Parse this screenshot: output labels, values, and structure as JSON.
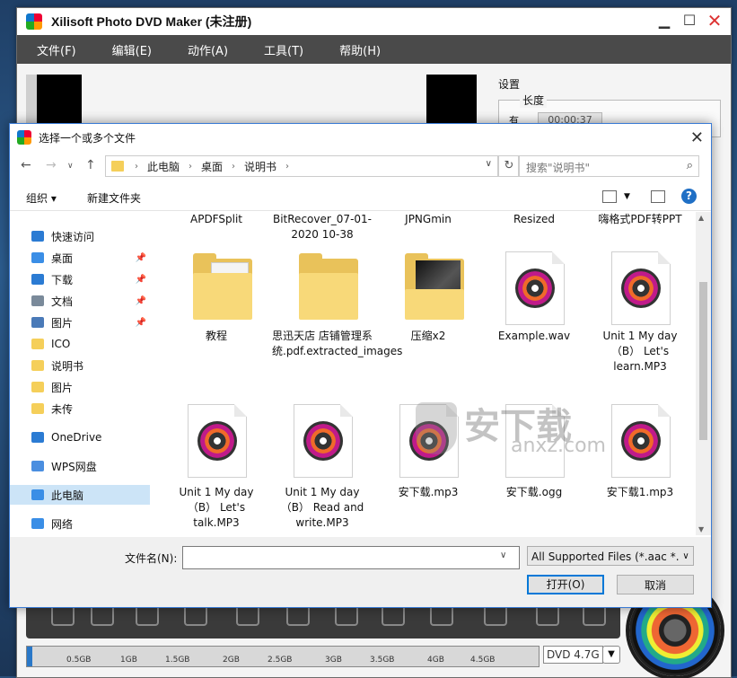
{
  "app": {
    "title": "Xilisoft Photo DVD Maker (未注册)",
    "menu": [
      "文件(F)",
      "编辑(E)",
      "动作(A)",
      "工具(T)",
      "帮助(H)"
    ],
    "settings_label": "设置",
    "duration_legend": "长度",
    "duration_label": "有",
    "duration_value": "00:00:37",
    "capacity_ticks": [
      "0.5GB",
      "1GB",
      "1.5GB",
      "2GB",
      "2.5GB",
      "3GB",
      "3.5GB",
      "4GB",
      "4.5GB"
    ],
    "capacity_used_fraction": 0.01,
    "dvd_type": "DVD 4.7G"
  },
  "dialog": {
    "title": "选择一个或多个文件",
    "breadcrumb": [
      "此电脑",
      "桌面",
      "说明书"
    ],
    "search_placeholder": "搜索\"说明书\"",
    "organize_label": "组织 ▾",
    "new_folder_label": "新建文件夹",
    "nav": [
      {
        "label": "快速访问",
        "icon": "star-icon",
        "pinned": false,
        "selected": false,
        "color": "#2b7bd3"
      },
      {
        "label": "桌面",
        "icon": "desktop-icon",
        "pinned": true,
        "selected": false,
        "color": "#3a8ee6"
      },
      {
        "label": "下载",
        "icon": "download-icon",
        "pinned": true,
        "selected": false,
        "color": "#2b7bd3"
      },
      {
        "label": "文档",
        "icon": "document-icon",
        "pinned": true,
        "selected": false,
        "color": "#7a8a9a"
      },
      {
        "label": "图片",
        "icon": "picture-icon",
        "pinned": true,
        "selected": false,
        "color": "#4a7ab8"
      },
      {
        "label": "ICO",
        "icon": "folder-icon",
        "pinned": false,
        "selected": false,
        "color": "#f5cf5a"
      },
      {
        "label": "说明书",
        "icon": "folder-icon",
        "pinned": false,
        "selected": false,
        "color": "#f5cf5a"
      },
      {
        "label": "图片",
        "icon": "folder-icon",
        "pinned": false,
        "selected": false,
        "color": "#f5cf5a"
      },
      {
        "label": "未传",
        "icon": "folder-icon",
        "pinned": false,
        "selected": false,
        "color": "#f5cf5a"
      },
      {
        "label": "OneDrive",
        "icon": "cloud-icon",
        "pinned": false,
        "selected": false,
        "color": "#2b7bd3"
      },
      {
        "label": "WPS网盘",
        "icon": "cloud-icon",
        "pinned": false,
        "selected": false,
        "color": "#4a8ee0"
      },
      {
        "label": "此电脑",
        "icon": "computer-icon",
        "pinned": false,
        "selected": true,
        "color": "#3a8ee6"
      },
      {
        "label": "网络",
        "icon": "network-icon",
        "pinned": false,
        "selected": false,
        "color": "#3a8ee6"
      }
    ],
    "files_row0": [
      "APDFSplit",
      "BitRecover_07-01-2020 10-38",
      "JPNGmin",
      "Resized",
      "嗨格式PDF转PPT"
    ],
    "files_row1": [
      {
        "name": "教程",
        "kind": "folder-docs"
      },
      {
        "name": "思迅天店 店铺管理系统.pdf.extracted_images",
        "kind": "folder"
      },
      {
        "name": "压缩x2",
        "kind": "folder-photo"
      },
      {
        "name": "Example.wav",
        "kind": "audio"
      },
      {
        "name": "Unit 1 My day （B） Let's learn.MP3",
        "kind": "audio"
      }
    ],
    "files_row2": [
      {
        "name": "Unit 1 My day （B） Let's talk.MP3",
        "kind": "audio"
      },
      {
        "name": "Unit 1 My day （B） Read and write.MP3",
        "kind": "audio"
      },
      {
        "name": "安下载.mp3",
        "kind": "audio"
      },
      {
        "name": "安下载.ogg",
        "kind": "blank"
      },
      {
        "name": "安下载1.mp3",
        "kind": "audio"
      }
    ],
    "filename_label": "文件名(N):",
    "filename_value": "",
    "filter_value": "All Supported Files (*.aac *.a",
    "open_label": "打开(O)",
    "cancel_label": "取消"
  },
  "watermark": {
    "big": "安下载",
    "small": "anxz.com"
  }
}
